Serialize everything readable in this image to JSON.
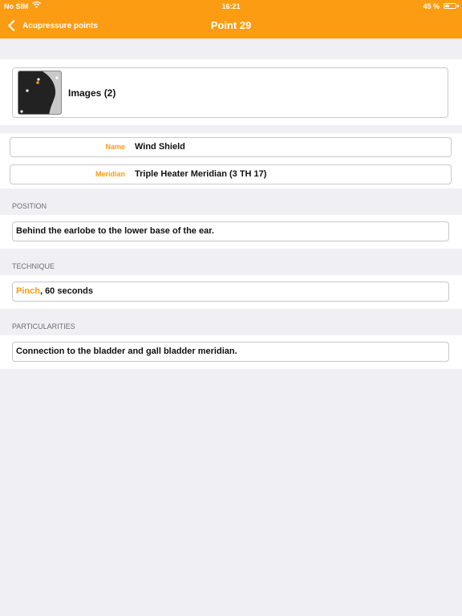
{
  "status_bar": {
    "carrier": "No SIM",
    "time": "16:21",
    "battery_text": "45 %",
    "battery_level": 0.45
  },
  "nav": {
    "back_label": "Acupressure points",
    "title": "Point 29"
  },
  "images": {
    "label": "Images (2)"
  },
  "fields": {
    "name_label": "Name",
    "name_value": "Wind Shield",
    "meridian_label": "Meridian",
    "meridian_value": "Triple Heater Meridian (3 TH 17)"
  },
  "position": {
    "header": "POSITION",
    "text": "Behind the earlobe to the lower base of the ear."
  },
  "technique": {
    "header": "TECHNIQUE",
    "method": "Pinch",
    "duration": ", 60 seconds"
  },
  "particularities": {
    "header": "PARTICULARITIES",
    "text": "Connection to the bladder and gall bladder meridian."
  },
  "colors": {
    "accent": "#fb9c12",
    "background": "#efeff4",
    "border": "#c8c8cc"
  }
}
